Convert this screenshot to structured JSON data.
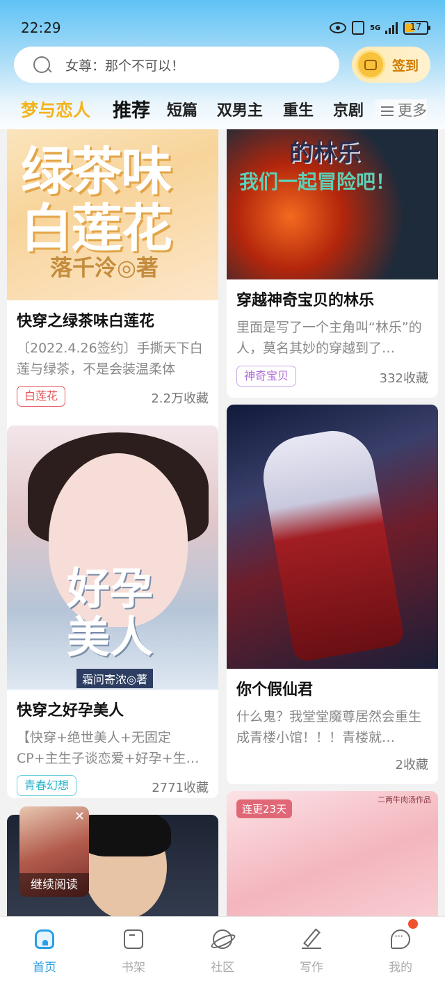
{
  "status": {
    "time": "22:29",
    "network": "5G",
    "battery": "17"
  },
  "search": {
    "placeholder": "女尊：那个不可以！"
  },
  "signin": {
    "label": "签到"
  },
  "tabs": [
    "梦与恋人",
    "推荐",
    "短篇",
    "双男主",
    "重生",
    "京剧"
  ],
  "more_label": "更多",
  "cards": [
    {
      "title": "快穿之绿茶味白莲花",
      "desc": "〔2022.4.26签约〕手撕天下白莲与绿茶，不是会装温柔体",
      "tag": "白莲花",
      "tag_color": "#e5545b",
      "fav": "2.2万收藏",
      "cover_text": "绿茶味白莲花",
      "cover_sub": "落千泠◎著"
    },
    {
      "title": "穿越神奇宝贝的林乐",
      "desc": "里面是写了一个主角叫“林乐”的人，莫名其妙的穿越到了…",
      "tag": "神奇宝贝",
      "tag_color": "#b06fd8",
      "fav": "332收藏",
      "cover_text": "的林乐",
      "cover_sub": "我们一起冒险吧！"
    },
    {
      "title": "快穿之好孕美人",
      "desc": "【快穿+绝世美人+无固定CP+主生子谈恋爱+好孕+生…",
      "tag": "青春幻想",
      "tag_color": "#2bb5c9",
      "fav": "2771收藏",
      "cover_text": "好孕美人",
      "cover_sub": "霜问寄浓◎著"
    },
    {
      "title": "你个假仙君",
      "desc": "什么鬼？我堂堂魔尊居然会重生成青楼小馆！！！青楼就…",
      "fav": "2收藏"
    },
    {
      "badge": "连更23天",
      "cover_sub": "二两牛肉汤作品"
    }
  ],
  "float": {
    "label": "继续阅读"
  },
  "nav": [
    "首页",
    "书架",
    "社区",
    "写作",
    "我的"
  ],
  "colors": {
    "accent": "#2a9ee6",
    "brand": "#f5b31b"
  }
}
